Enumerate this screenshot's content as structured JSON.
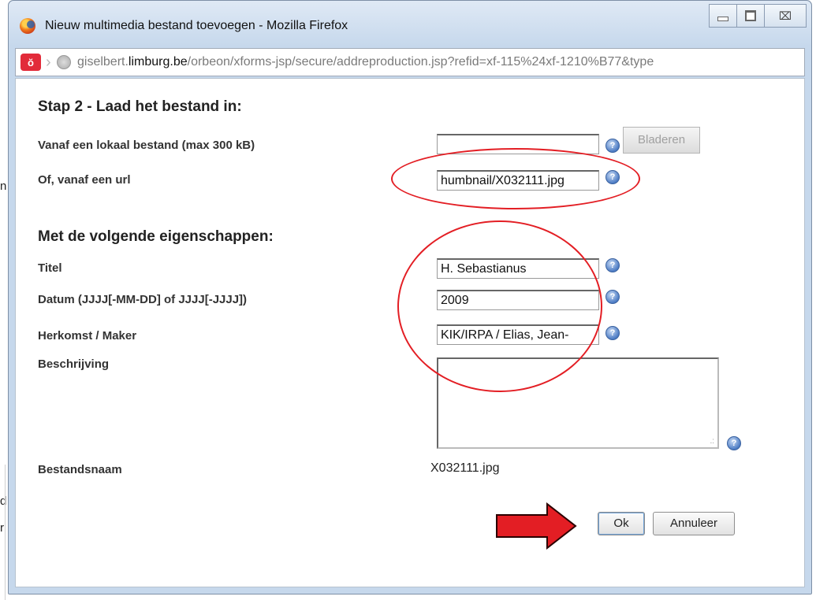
{
  "window": {
    "title": "Nieuw multimedia bestand toevoegen - Mozilla Firefox",
    "close_glyph": "⌧",
    "url_prefix": "giselbert.",
    "url_host": "limburg.be",
    "url_path": "/orbeon/xforms-jsp/secure/addreproduction.jsp?refid=xf-115%24xf-1210%B77&type"
  },
  "background_fragments": [
    "n",
    "d",
    "r"
  ],
  "step": {
    "title": "Stap 2 - Laad het bestand in:",
    "local_label": "Vanaf een lokaal bestand",
    "local_label_extra": "(max 300 kB)",
    "local_value": "",
    "browse_label": "Bladeren",
    "url_label": "Of, vanaf een url",
    "url_value": "humbnail/X032111.jpg"
  },
  "properties": {
    "title": "Met de volgende eigenschappen:",
    "titel_label": "Titel",
    "titel_value": "H. Sebastianus",
    "datum_label": "Datum (JJJJ[-MM-DD] of JJJJ[-JJJJ])",
    "datum_value": "2009",
    "herkomst_label": "Herkomst / Maker",
    "herkomst_value": "KIK/IRPA / Elias, Jean-",
    "beschrijving_label": "Beschrijving",
    "beschrijving_value": "",
    "bestandsnaam_label": "Bestandsnaam",
    "bestandsnaam_value": "X032111.jpg"
  },
  "buttons": {
    "ok": "Ok",
    "cancel": "Annuleer"
  },
  "colors": {
    "annotation_red": "#e31e24",
    "help_blue": "#4d7cc4"
  },
  "icons": {
    "help": "help-icon",
    "arrow": "red-arrow-icon"
  }
}
